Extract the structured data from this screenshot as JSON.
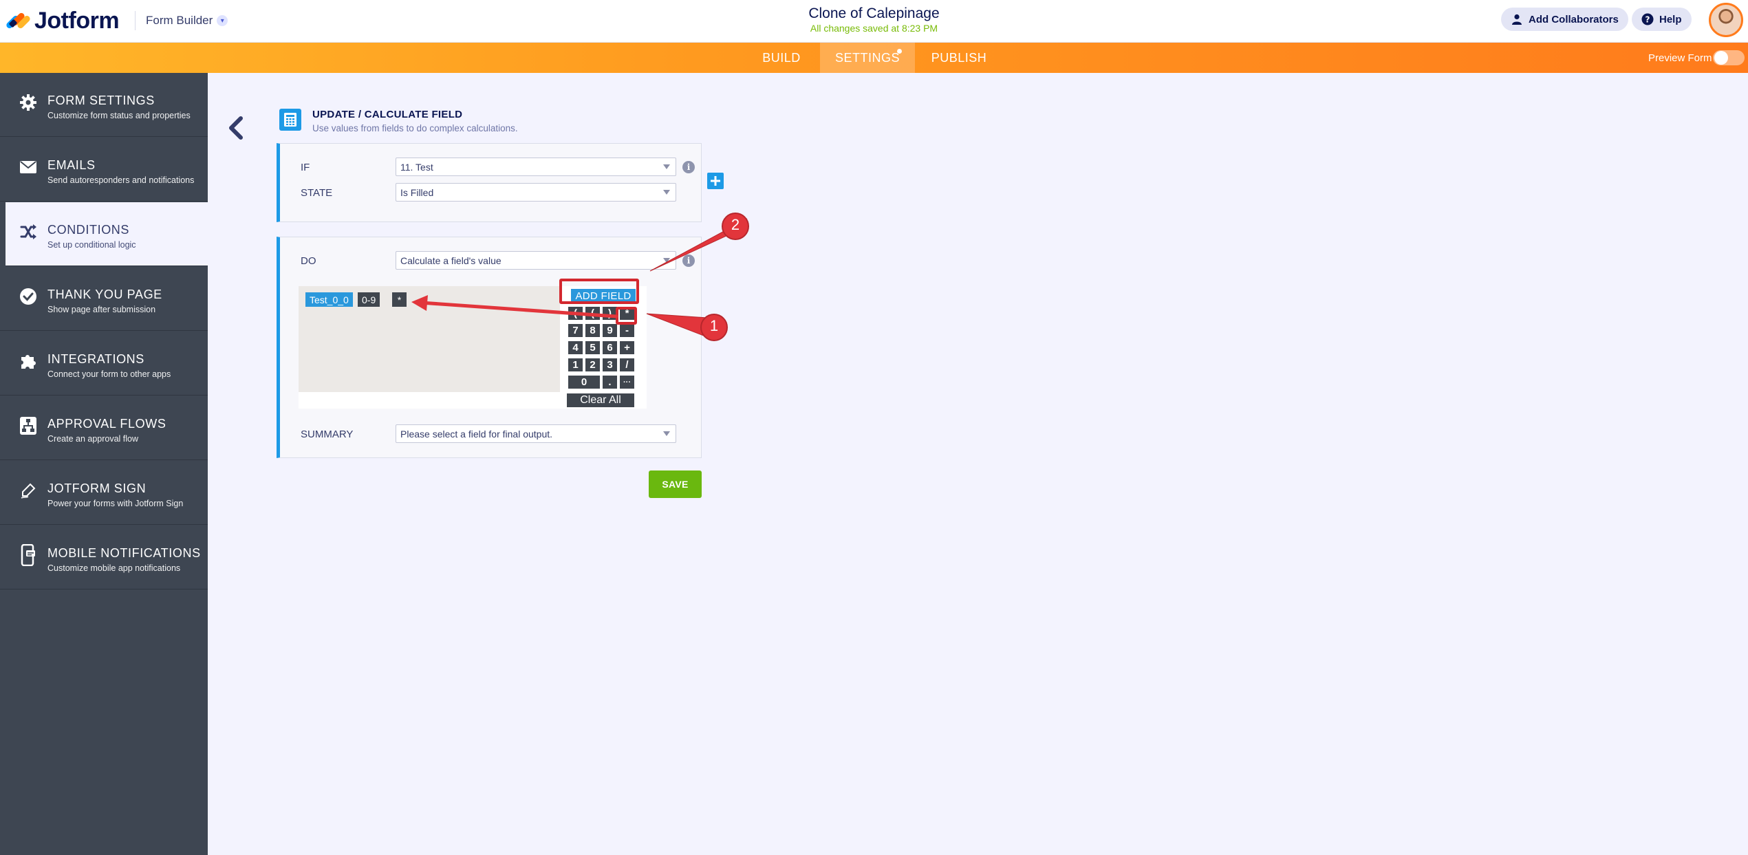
{
  "app": {
    "brand": "Jotform",
    "builder_label": "Form Builder",
    "form_title": "Clone of Calepinage",
    "saved_message": "All changes saved at 8:23 PM",
    "add_collaborators": "Add Collaborators",
    "help": "Help"
  },
  "nav": {
    "tabs": [
      {
        "label": "BUILD",
        "active": false
      },
      {
        "label": "SETTINGS",
        "active": true
      },
      {
        "label": "PUBLISH",
        "active": false
      }
    ],
    "preview_label": "Preview Form"
  },
  "sidebar": {
    "items": [
      {
        "title": "FORM SETTINGS",
        "subtitle": "Customize form status and properties",
        "icon": "gear-icon"
      },
      {
        "title": "EMAILS",
        "subtitle": "Send autoresponders and notifications",
        "icon": "envelope-icon"
      },
      {
        "title": "CONDITIONS",
        "subtitle": "Set up conditional logic",
        "icon": "shuffle-icon",
        "active": true
      },
      {
        "title": "THANK YOU PAGE",
        "subtitle": "Show page after submission",
        "icon": "check-circle-icon"
      },
      {
        "title": "INTEGRATIONS",
        "subtitle": "Connect your form to other apps",
        "icon": "puzzle-icon"
      },
      {
        "title": "APPROVAL FLOWS",
        "subtitle": "Create an approval flow",
        "icon": "flow-icon"
      },
      {
        "title": "JOTFORM SIGN",
        "subtitle": "Power your forms with Jotform Sign",
        "icon": "pen-icon"
      },
      {
        "title": "MOBILE NOTIFICATIONS",
        "subtitle": "Customize mobile app notifications",
        "icon": "mobile-icon"
      }
    ]
  },
  "condition": {
    "header_title": "UPDATE / CALCULATE FIELD",
    "header_subtitle": "Use values from fields to do complex calculations.",
    "if_label": "IF",
    "if_value": "11. Test",
    "state_label": "STATE",
    "state_value": "Is Filled",
    "do_label": "DO",
    "do_value": "Calculate a field's value",
    "summary_label": "SUMMARY",
    "summary_placeholder": "Please select a field for final output.",
    "save_label": "SAVE"
  },
  "calculator": {
    "tokens": {
      "field": "Test_0_0",
      "range": "0-9",
      "operator": "*"
    },
    "add_field_label": "ADD FIELD",
    "clear_all_label": "Clear All",
    "keys": [
      {
        "label": "(",
        "row": 0,
        "col": 0
      },
      {
        "label": "(",
        "row": 0,
        "col": 1
      },
      {
        "label": ")",
        "row": 0,
        "col": 2
      },
      {
        "label": "*",
        "row": 0,
        "col": 3
      },
      {
        "label": "7",
        "row": 1,
        "col": 0
      },
      {
        "label": "8",
        "row": 1,
        "col": 1
      },
      {
        "label": "9",
        "row": 1,
        "col": 2
      },
      {
        "label": "-",
        "row": 1,
        "col": 3
      },
      {
        "label": "4",
        "row": 2,
        "col": 0
      },
      {
        "label": "5",
        "row": 2,
        "col": 1
      },
      {
        "label": "6",
        "row": 2,
        "col": 2
      },
      {
        "label": "+",
        "row": 2,
        "col": 3
      },
      {
        "label": "1",
        "row": 3,
        "col": 0
      },
      {
        "label": "2",
        "row": 3,
        "col": 1
      },
      {
        "label": "3",
        "row": 3,
        "col": 2
      },
      {
        "label": "/",
        "row": 3,
        "col": 3
      },
      {
        "label": "0",
        "row": 4,
        "col": 0,
        "span": 2
      },
      {
        "label": ".",
        "row": 4,
        "col": 2
      },
      {
        "label": "···",
        "row": 4,
        "col": 3
      }
    ]
  },
  "annotations": {
    "badge_1": "1",
    "badge_2": "2",
    "color": "#e2353b"
  }
}
